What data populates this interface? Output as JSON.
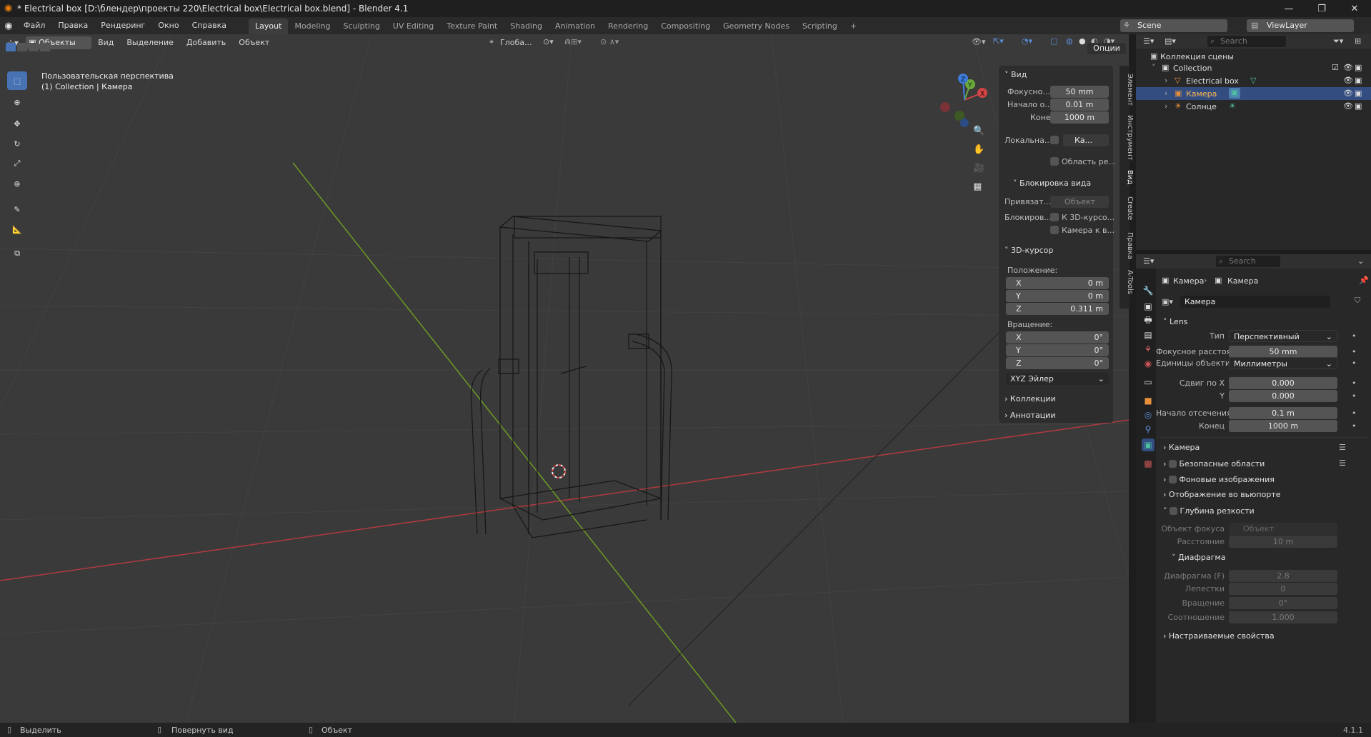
{
  "window": {
    "title": "* Electrical box [D:\\блендер\\проекты 220\\Electrical box\\Electrical box.blend] - Blender 4.1",
    "minimize": "—",
    "maximize": "❐",
    "close": "✕"
  },
  "menu": {
    "file": "Файл",
    "edit": "Правка",
    "render": "Рендеринг",
    "window": "Окно",
    "help": "Справка"
  },
  "workspaces": [
    "Layout",
    "Modeling",
    "Sculpting",
    "UV Editing",
    "Texture Paint",
    "Shading",
    "Animation",
    "Rendering",
    "Compositing",
    "Geometry Nodes",
    "Scripting",
    "+"
  ],
  "scene": {
    "scene_name": "Scene",
    "view_layer": "ViewLayer"
  },
  "viewport_header": {
    "mode": "Объекты",
    "view": "Вид",
    "select": "Выделение",
    "add": "Добавить",
    "object": "Объект",
    "transform": "Глоба...",
    "options": "Опции"
  },
  "viewport": {
    "perspective": "Пользовательская перспектива",
    "collection_info": "(1) Collection | Камера",
    "accent_x": "#c0393b",
    "accent_y": "#6a9b1e"
  },
  "n_panel": {
    "view_header": "Вид",
    "focal_label": "Фокусно...",
    "focal_value": "50 mm",
    "clip_start_label": "Начало о...",
    "clip_start_value": "0.01 m",
    "clip_end_label": "Конец",
    "clip_end_value": "1000 m",
    "local_label": "Локальна...",
    "local_value": "Ка...",
    "render_region": "Область ре...",
    "lock_header": "Блокировка вида",
    "lock_to_label": "Привязат...",
    "lock_to_value": "Объект",
    "lock_label": "Блокиров...",
    "lock_3d_cursor": "К 3D-курсо...",
    "camera_to_view": "Камера к в...",
    "cursor_header": "3D-курсор",
    "location_label": "Положение:",
    "loc_x_label": "X",
    "loc_x": "0 m",
    "loc_y_label": "Y",
    "loc_y": "0 m",
    "loc_z_label": "Z",
    "loc_z": "0.311 m",
    "rotation_label": "Вращение:",
    "rot_x_label": "X",
    "rot_x": "0°",
    "rot_y_label": "Y",
    "rot_y": "0°",
    "rot_z_label": "Z",
    "rot_z": "0°",
    "rotation_mode": "XYZ Эйлер",
    "collections": "Коллекции",
    "annotations": "Аннотации"
  },
  "side_tabs": [
    "Элемент",
    "Инструмент",
    "Вид",
    "Create",
    "Правка",
    "A-Tools"
  ],
  "outliner": {
    "search_placeholder": "Search",
    "scene_collection": "Коллекция сцены",
    "collection": "Collection",
    "items": [
      {
        "name": "Electrical box"
      },
      {
        "name": "Камера"
      },
      {
        "name": "Солнце"
      }
    ]
  },
  "properties": {
    "search_placeholder": "Search",
    "breadcrumb_object": "Камера",
    "breadcrumb_data": "Камера",
    "datablock": "Камера",
    "lens_header": "Lens",
    "type_label": "Тип",
    "type_value": "Перспективный",
    "focal_label": "Фокусное расстоя...",
    "focal_value": "50 mm",
    "units_label": "Единицы объектива",
    "units_value": "Миллиметры",
    "shift_x_label": "Сдвиг по X",
    "shift_x": "0.000",
    "shift_y_label": "Y",
    "shift_y": "0.000",
    "clip_start_label": "Начало отсечения",
    "clip_start": "0.1 m",
    "clip_end_label": "Конец",
    "clip_end": "1000 m",
    "camera_section": "Камера",
    "safe_areas": "Безопасные области",
    "bg_images": "Фоновые изображения",
    "viewport_display": "Отображение во вьюпорте",
    "dof": "Глубина резкости",
    "focus_object_label": "Объект фокуса",
    "focus_object_placeholder": "Объект",
    "distance_label": "Расстояние",
    "distance": "10 m",
    "aperture_header": "Диафрагма",
    "fstop_label": "Диафрагма (F)",
    "fstop": "2.8",
    "blades_label": "Лепестки",
    "blades": "0",
    "rotation_label": "Вращение",
    "rotation": "0°",
    "ratio_label": "Соотношение",
    "ratio": "1.000",
    "custom_props": "Настраиваемые свойства"
  },
  "statusbar": {
    "select": "Выделить",
    "rotate_view": "Повернуть вид",
    "object": "Объект",
    "version": "4.1.1"
  }
}
